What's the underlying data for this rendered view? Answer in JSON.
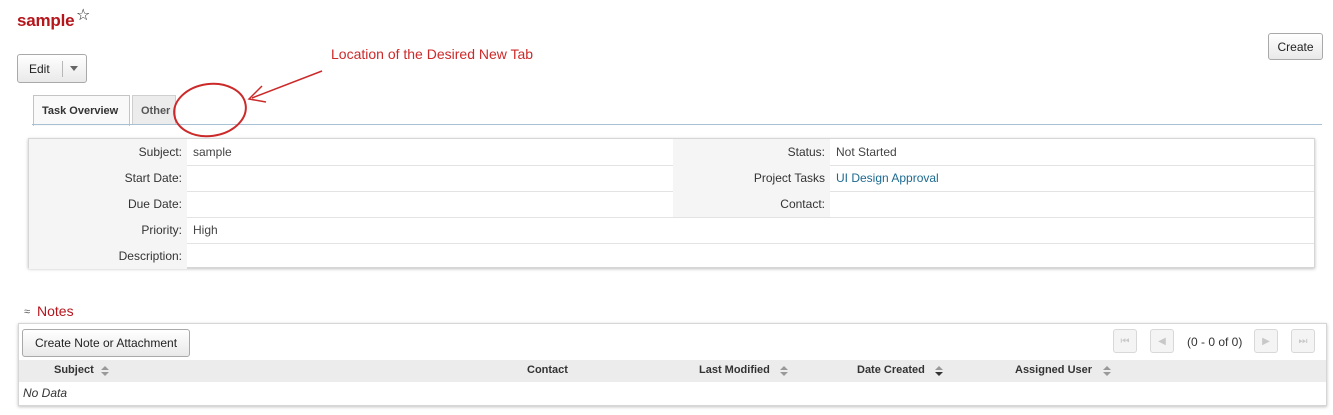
{
  "record": {
    "title": "sample",
    "favorite_icon": "star-outline-icon"
  },
  "toolbar": {
    "edit_label": "Edit",
    "create_label": "Create"
  },
  "tabs": [
    {
      "label": "Task Overview"
    },
    {
      "label": "Other"
    }
  ],
  "annotation": {
    "text": "Location of the Desired New Tab",
    "color": "#cc2a2a"
  },
  "details": {
    "subject_label": "Subject:",
    "subject_value": "sample",
    "status_label": "Status:",
    "status_value": "Not Started",
    "start_label": "Start Date:",
    "start_value": "",
    "project_label": "Project Tasks",
    "project_value": "UI Design Approval",
    "due_label": "Due Date:",
    "due_value": "",
    "contact_label": "Contact:",
    "contact_value": "",
    "priority_label": "Priority:",
    "priority_value": "High",
    "description_label": "Description:",
    "description_value": ""
  },
  "notes": {
    "title": "Notes",
    "create_button": "Create Note or Attachment",
    "pager_text": "(0 - 0 of 0)",
    "columns": [
      "Subject",
      "Contact",
      "Last Modified",
      "Date Created",
      "Assigned User"
    ],
    "empty_text": "No Data"
  },
  "colors": {
    "brand_red": "#b5161c",
    "link_blue": "#1d6a90"
  }
}
